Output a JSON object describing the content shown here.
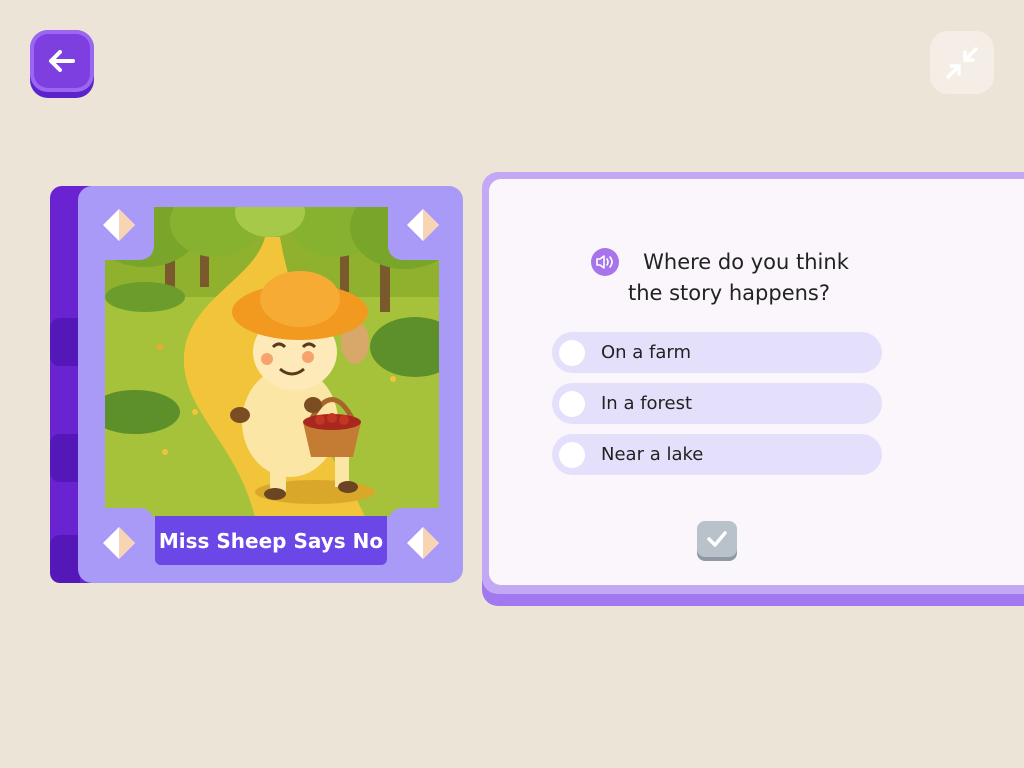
{
  "nav": {
    "back_icon": "arrow-left-icon",
    "collapse_icon": "collapse-arrows-icon"
  },
  "book": {
    "title": "Miss Sheep Says No",
    "illustration": "sheep-with-basket-on-forest-path"
  },
  "quiz": {
    "question": "Where do you think the story happens?",
    "audio_icon": "speaker-icon",
    "options": [
      {
        "label": "On a farm",
        "selected": false
      },
      {
        "label": "In a forest",
        "selected": false
      },
      {
        "label": "Near a lake",
        "selected": false
      }
    ],
    "submit_icon": "checkmark-icon"
  },
  "colors": {
    "background": "#ede4d8",
    "accent_purple": "#7d3fe0",
    "book_cover": "#a99af7",
    "title_banner": "#6b47e8",
    "option_bg": "#e4e0fb",
    "submit_disabled": "#b9c2ca"
  }
}
